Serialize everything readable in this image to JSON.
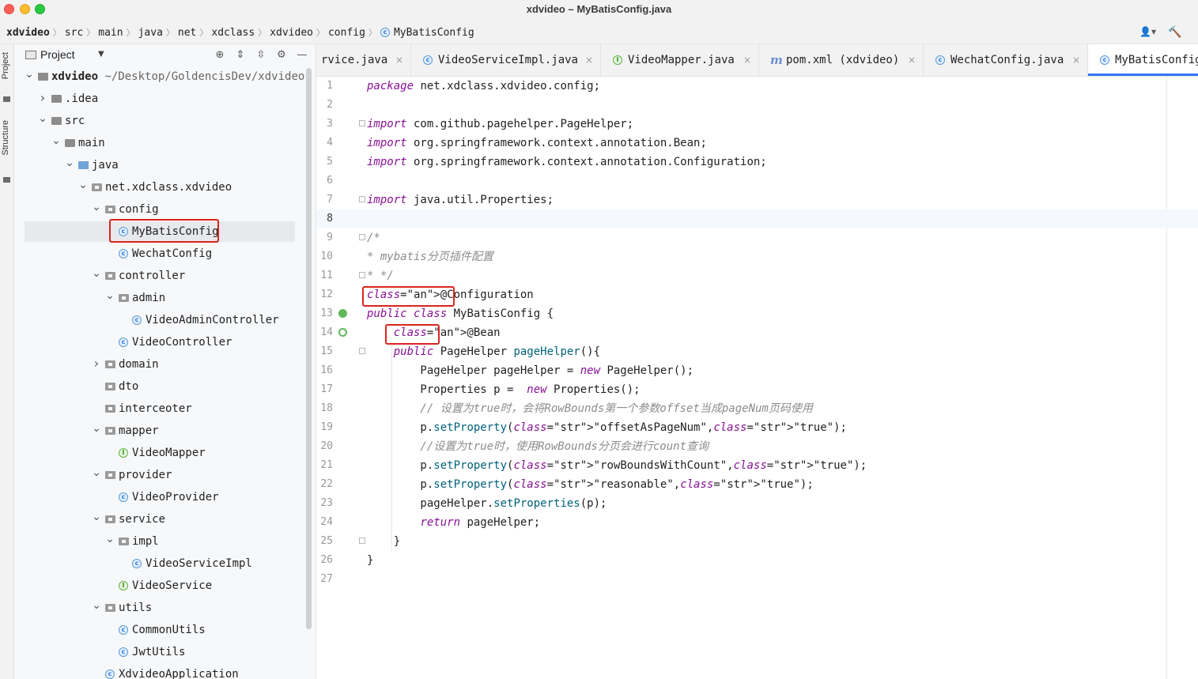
{
  "window": {
    "title": "xdvideo – MyBatisConfig.java"
  },
  "breadcrumb": [
    "xdvideo",
    "src",
    "main",
    "java",
    "net",
    "xdclass",
    "xdvideo",
    "config",
    "MyBatisConfig"
  ],
  "panel": {
    "title": "Project"
  },
  "toolstrip": {
    "project_label": "Project",
    "structure_label": "Structure"
  },
  "tree": [
    {
      "label": "xdvideo",
      "extra": "~/Desktop/GoldencisDev/xdvideo",
      "type": "module",
      "depth": 0,
      "chevron": "down"
    },
    {
      "label": ".idea",
      "type": "folder",
      "depth": 1,
      "chevron": "right"
    },
    {
      "label": "src",
      "type": "folder",
      "depth": 1,
      "chevron": "down"
    },
    {
      "label": "main",
      "type": "folder",
      "depth": 2,
      "chevron": "down"
    },
    {
      "label": "java",
      "type": "source",
      "depth": 3,
      "chevron": "down"
    },
    {
      "label": "net.xdclass.xdvideo",
      "type": "package",
      "depth": 4,
      "chevron": "down"
    },
    {
      "label": "config",
      "type": "package",
      "depth": 5,
      "chevron": "down"
    },
    {
      "label": "MyBatisConfig",
      "type": "class",
      "depth": 6,
      "selected": true
    },
    {
      "label": "WechatConfig",
      "type": "class",
      "depth": 6
    },
    {
      "label": "controller",
      "type": "package",
      "depth": 5,
      "chevron": "down"
    },
    {
      "label": "admin",
      "type": "package",
      "depth": 6,
      "chevron": "down"
    },
    {
      "label": "VideoAdminController",
      "type": "class",
      "depth": 7
    },
    {
      "label": "VideoController",
      "type": "class",
      "depth": 6
    },
    {
      "label": "domain",
      "type": "package",
      "depth": 5,
      "chevron": "right"
    },
    {
      "label": "dto",
      "type": "package",
      "depth": 5
    },
    {
      "label": "interceoter",
      "type": "package",
      "depth": 5
    },
    {
      "label": "mapper",
      "type": "package",
      "depth": 5,
      "chevron": "down"
    },
    {
      "label": "VideoMapper",
      "type": "interface",
      "depth": 6
    },
    {
      "label": "provider",
      "type": "package",
      "depth": 5,
      "chevron": "down"
    },
    {
      "label": "VideoProvider",
      "type": "class",
      "depth": 6
    },
    {
      "label": "service",
      "type": "package",
      "depth": 5,
      "chevron": "down"
    },
    {
      "label": "impl",
      "type": "package",
      "depth": 6,
      "chevron": "down"
    },
    {
      "label": "VideoServiceImpl",
      "type": "class",
      "depth": 7
    },
    {
      "label": "VideoService",
      "type": "interface",
      "depth": 6
    },
    {
      "label": "utils",
      "type": "package",
      "depth": 5,
      "chevron": "down"
    },
    {
      "label": "CommonUtils",
      "type": "class",
      "depth": 6
    },
    {
      "label": "JwtUtils",
      "type": "class",
      "depth": 6
    },
    {
      "label": "XdvideoApplication",
      "type": "class",
      "depth": 5
    }
  ],
  "tabs": [
    {
      "label": "rvice.java",
      "icon": "none"
    },
    {
      "label": "VideoServiceImpl.java",
      "icon": "class"
    },
    {
      "label": "VideoMapper.java",
      "icon": "interface"
    },
    {
      "label": "pom.xml (xdvideo)",
      "icon": "maven"
    },
    {
      "label": "WechatConfig.java",
      "icon": "class"
    },
    {
      "label": "MyBatisConfig",
      "icon": "class",
      "active": true
    }
  ],
  "code_lines": [
    "package net.xdclass.xdvideo.config;",
    "",
    "import com.github.pagehelper.PageHelper;",
    "import org.springframework.context.annotation.Bean;",
    "import org.springframework.context.annotation.Configuration;",
    "",
    "import java.util.Properties;",
    "",
    "/*",
    "* mybatis分页插件配置",
    "* */",
    "@Configuration",
    "public class MyBatisConfig {",
    "    @Bean",
    "    public PageHelper pageHelper(){",
    "        PageHelper pageHelper = new PageHelper();",
    "        Properties p =  new Properties();",
    "        // 设置为true时，会将RowBounds第一个参数offset当成pageNum页码使用",
    "        p.setProperty(\"offsetAsPageNum\",\"true\");",
    "        //设置为true时，使用RowBounds分页会进行count查询",
    "        p.setProperty(\"rowBoundsWithCount\",\"true\");",
    "        p.setProperty(\"reasonable\",\"true\");",
    "        pageHelper.setProperties(p);",
    "        return pageHelper;",
    "    }",
    "}",
    ""
  ],
  "current_line": 8,
  "colors": {
    "accent": "#3574f0",
    "highlight": "#d9261c"
  }
}
